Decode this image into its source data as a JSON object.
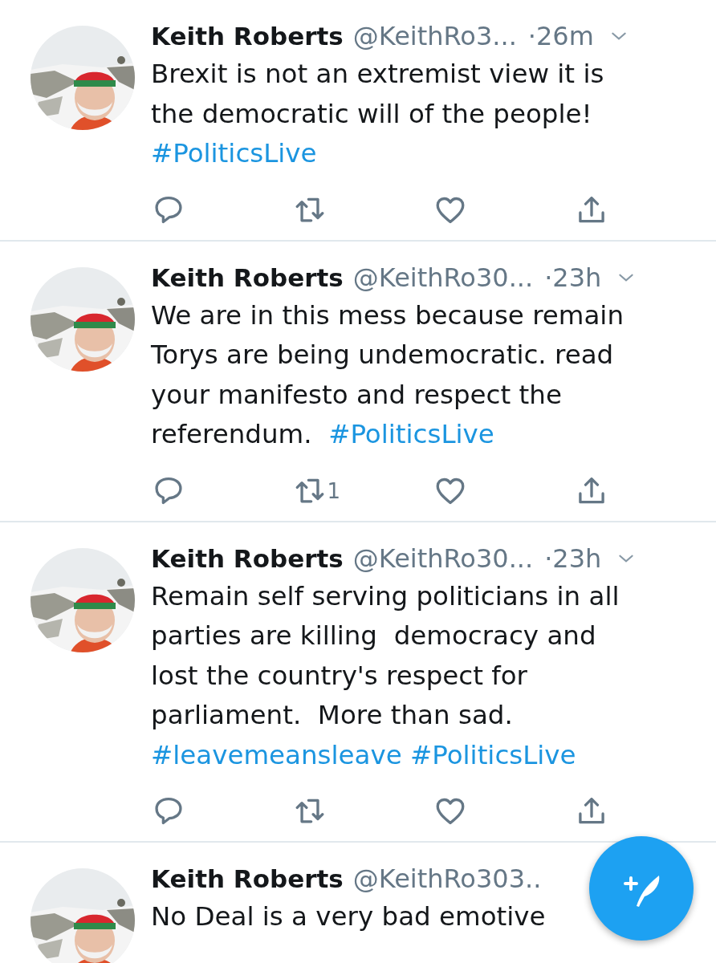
{
  "tweets": [
    {
      "name": "Keith Roberts",
      "handle": "@KeithRo3...",
      "time": "·26m",
      "avatar": {
        "kind": "picture"
      },
      "lines": [
        [
          {
            "kind": "text",
            "text": "Brexit is not an extremist view it is"
          }
        ],
        [
          {
            "kind": "text",
            "text": "the democratic will of the people!"
          }
        ],
        [
          {
            "kind": "hashtag",
            "text": "#PoliticsLive"
          }
        ]
      ],
      "actions": [
        {
          "kind": "reply"
        },
        {
          "kind": "retweet"
        },
        {
          "kind": "like"
        },
        {
          "kind": "share"
        }
      ]
    },
    {
      "name": "Keith Roberts",
      "handle": "@KeithRo30...",
      "time": "·23h",
      "avatar": {
        "kind": "picture"
      },
      "lines": [
        [
          {
            "kind": "text",
            "text": "We are in this mess because remain"
          }
        ],
        [
          {
            "kind": "text",
            "text": "Torys are being undemocratic. read"
          }
        ],
        [
          {
            "kind": "text",
            "text": "your manifesto and respect the"
          }
        ],
        [
          {
            "kind": "text",
            "text": "referendum.  "
          },
          {
            "kind": "hashtag",
            "text": "#PoliticsLive"
          }
        ]
      ],
      "actions": [
        {
          "kind": "reply"
        },
        {
          "kind": "retweet",
          "count": "1"
        },
        {
          "kind": "like"
        },
        {
          "kind": "share"
        }
      ]
    },
    {
      "name": "Keith Roberts",
      "handle": "@KeithRo30...",
      "time": "·23h",
      "avatar": {
        "kind": "picture"
      },
      "lines": [
        [
          {
            "kind": "text",
            "text": "Remain self serving politicians in all"
          }
        ],
        [
          {
            "kind": "text",
            "text": "parties are killing  democracy and"
          }
        ],
        [
          {
            "kind": "text",
            "text": "lost the country's respect for"
          }
        ],
        [
          {
            "kind": "text",
            "text": "parliament.  More than sad."
          }
        ],
        [
          {
            "kind": "hashtag",
            "text": "#leavemeansleave"
          },
          {
            "kind": "hashtag",
            "text": "#PoliticsLive",
            "space_before": true
          }
        ]
      ],
      "actions": [
        {
          "kind": "reply"
        },
        {
          "kind": "retweet"
        },
        {
          "kind": "like"
        },
        {
          "kind": "share"
        }
      ]
    },
    {
      "name": "Keith Roberts",
      "handle": "@KeithRo303..",
      "avatar": {
        "kind": "picture"
      },
      "lines": [
        [
          {
            "kind": "text",
            "text": "No Deal is a very bad emotive"
          }
        ]
      ]
    }
  ],
  "compose_button": {
    "kind": "compose"
  }
}
